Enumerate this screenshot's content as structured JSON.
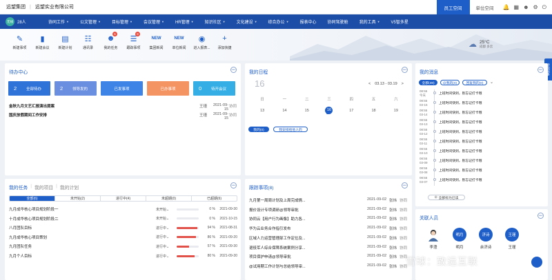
{
  "header": {
    "org_name": "远望集团",
    "company_name": "远望实业有限公司",
    "tabs": [
      {
        "label": "员工空间",
        "active": true
      },
      {
        "label": "单位空间",
        "active": false
      }
    ],
    "icons": [
      "bell-icon",
      "grid-icon",
      "people-icon",
      "settings-icon",
      "power-icon"
    ]
  },
  "user": {
    "avatar_text": "无线",
    "name": "28人"
  },
  "nav": {
    "items": [
      {
        "label": "协同工作",
        "has_caret": true
      },
      {
        "label": "公文管理",
        "has_caret": true
      },
      {
        "label": "目标管理",
        "has_caret": true
      },
      {
        "label": "会议管理",
        "has_caret": true
      },
      {
        "label": "HR管理",
        "has_caret": true
      },
      {
        "label": "知识社区",
        "has_caret": true
      },
      {
        "label": "文化建设",
        "has_caret": true
      },
      {
        "label": "综合办公",
        "has_caret": true
      },
      {
        "label": "报表中心",
        "has_caret": false
      },
      {
        "label": "协同驾驶舱",
        "has_caret": false
      },
      {
        "label": "我的工具",
        "has_caret": true
      },
      {
        "label": "V5智多星",
        "has_caret": false
      }
    ]
  },
  "quick": {
    "items": [
      {
        "label": "新建事项",
        "icon": "new-item-icon",
        "badge": ""
      },
      {
        "label": "新建会议",
        "icon": "meeting-icon",
        "badge": ""
      },
      {
        "label": "新建计划",
        "icon": "plan-icon",
        "badge": ""
      },
      {
        "label": "通讯录",
        "icon": "contacts-icon",
        "badge": ""
      },
      {
        "label": "我的任务",
        "icon": "task-icon",
        "badge": "6"
      },
      {
        "label": "跟踪事项",
        "icon": "track-icon",
        "badge": "8"
      },
      {
        "label": "集团新闻",
        "icon": "news-icon",
        "badge": ""
      },
      {
        "label": "单位新闻",
        "icon": "unit-news-icon",
        "badge": ""
      },
      {
        "label": "进入报表...",
        "icon": "report-icon",
        "badge": ""
      },
      {
        "label": "添加快捷",
        "icon": "plus-icon",
        "badge": ""
      }
    ]
  },
  "weather": {
    "temp": "25°C",
    "location": "成都 多云"
  },
  "todo": {
    "title": "待办中心",
    "tiles": [
      {
        "num": "2",
        "label": "全部待办",
        "color": "#2f72d8"
      },
      {
        "num": "2",
        "label": "领导发的",
        "color": "#6b8fe0"
      },
      {
        "num": "",
        "label": "已发事项",
        "color": "#3d84e6"
      },
      {
        "num": "",
        "label": "已办事项",
        "color": "#f59463"
      },
      {
        "num": "0",
        "label": "待开会议",
        "color": "#35aee6"
      }
    ],
    "rows": [
      {
        "title": "金秋九月文艺汇报演出提案",
        "user": "王瑾",
        "date": "2021-09-15",
        "src": "协同"
      },
      {
        "title": "国庆放假期间工作安排",
        "user": "王瑾",
        "date": "2021-09-15",
        "src": "协同"
      }
    ]
  },
  "schedule": {
    "title": "我的日程",
    "big_day": "16",
    "range": "03.13 - 03.19",
    "prev": "<",
    "next": ">",
    "weekdays": [
      "日",
      "一",
      "二",
      "三",
      "四",
      "五",
      "六"
    ],
    "days": [
      "13",
      "14",
      "15",
      "16",
      "17",
      "18",
      "19"
    ],
    "today": "16",
    "pills": [
      "我的(0)",
      "我安排给他人的"
    ]
  },
  "messages": {
    "title": "我的消息",
    "tabs": [
      "全部(49)",
      "@我的(0)",
      "回复我的(0)"
    ],
    "items": [
      {
        "time": "08:55",
        "date": "今天",
        "text": "上班时间快到，别忘记打卡哦"
      },
      {
        "time": "08:55",
        "date": "03-15",
        "text": "上班时间快到，别忘记打卡哦"
      },
      {
        "time": "08:55",
        "date": "03-14",
        "text": "上班时间快到，别忘记打卡哦"
      },
      {
        "time": "08:55",
        "date": "03-13",
        "text": "上班时间快到，别忘记打卡哦"
      },
      {
        "time": "08:55",
        "date": "03-12",
        "text": "上班时间快到，别忘记打卡哦"
      },
      {
        "time": "08:55",
        "date": "03-11",
        "text": "上班时间快到，别忘记打卡哦"
      },
      {
        "time": "08:55",
        "date": "03-10",
        "text": "上班时间快到，别忘记打卡哦"
      },
      {
        "time": "08:55",
        "date": "03-09",
        "text": "上班时间快到，别忘记打卡哦"
      },
      {
        "time": "08:55",
        "date": "03-08",
        "text": "上班时间快到，别忘记打卡哦"
      },
      {
        "time": "08:55",
        "date": "03-07",
        "text": "上班时间快到，别忘记打卡哦"
      }
    ],
    "all_read": "全部标为已读"
  },
  "tasks": {
    "tabs": [
      "我的任务",
      "我的项目",
      "我的计划"
    ],
    "filters": [
      "全部(6)",
      "未开始(2)",
      "进行中(4)",
      "未超期(0)",
      "已超期(6)"
    ],
    "rows": [
      {
        "name": "九月成华核心项目规划阶段一",
        "status": "未开始",
        "progress": 0,
        "pct": "0 %",
        "date": "2021-09-30"
      },
      {
        "name": "十月成华核心项目规划阶段二",
        "status": "未开始",
        "progress": 0,
        "pct": "0 %",
        "date": "2021-10-15"
      },
      {
        "name": "八月团队目标",
        "status": "进行中",
        "progress": 94,
        "pct": "94 %",
        "date": "2021-08-31"
      },
      {
        "name": "九月成华核心项目策划",
        "status": "进行中",
        "progress": 86,
        "pct": "86 %",
        "date": "2021-09-20"
      },
      {
        "name": "九月团队任务",
        "status": "进行中",
        "progress": 57,
        "pct": "57 %",
        "date": "2021-09-30"
      },
      {
        "name": "九月个人目标",
        "status": "进行中",
        "progress": 80,
        "pct": "80 %",
        "date": "2021-09-30"
      }
    ]
  },
  "tracking": {
    "title": "跟踪事项(8)",
    "rows": [
      {
        "name": "九月第一周周计划及上周完成情...",
        "date": "2021-09-02",
        "user": "张炜",
        "src": "协同"
      },
      {
        "name": "报价设计专项调研@领导审批",
        "date": "2021-09-02",
        "user": "张炜",
        "src": "协同"
      },
      {
        "name": "协同云【用户行为画像】助力各...",
        "date": "2021-09-02",
        "user": "张炜",
        "src": "协同"
      },
      {
        "name": "华为云业务合作指引发布",
        "date": "2021-09-02",
        "user": "张炜",
        "src": "协同"
      },
      {
        "name": "区域人力运营管理部工作定位及...",
        "date": "2021-09-02",
        "user": "张炜",
        "src": "协同"
      },
      {
        "name": "退役军人综合保障系统案例分享...",
        "date": "2021-09-02",
        "user": "张炜",
        "src": "协同"
      },
      {
        "name": "项目保护申请@领导审批",
        "date": "2021-09-02",
        "user": "张炜",
        "src": "协同"
      },
      {
        "name": "@试用期工作计划与总结领导审...",
        "date": "2021-09-02",
        "user": "张炜",
        "src": "协同"
      }
    ]
  },
  "contacts": {
    "title": "关联人员",
    "people": [
      {
        "name": "李澄",
        "avatar": "photo"
      },
      {
        "name": "明月",
        "avatar": "明月"
      },
      {
        "name": "余济诗",
        "avatar": "济诗"
      },
      {
        "name": "王瑾",
        "avatar": "王瑾"
      }
    ]
  },
  "side_tab": "待我驾事",
  "watermark": "雪球：致远互联",
  "colors": {
    "primary": "#1e5ec8",
    "nav": "#1c4ea8",
    "progress": "#e2504a",
    "badge": "#e84b3c"
  }
}
